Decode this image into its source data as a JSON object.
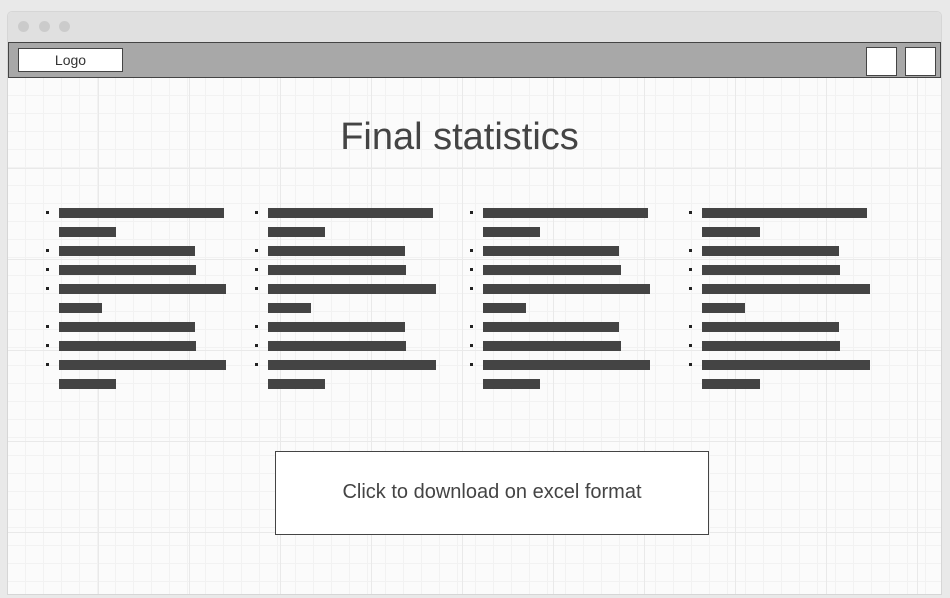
{
  "window": {
    "title": ""
  },
  "toolbar": {
    "logo_label": "Logo",
    "buttons": [
      "toolbar-button-1",
      "toolbar-button-2"
    ]
  },
  "main": {
    "title": "Final statistics",
    "columns": [
      {
        "items": [
          {
            "lines": 2
          },
          {
            "lines": 1
          },
          {
            "lines": 1
          },
          {
            "lines": 2
          },
          {
            "lines": 1
          },
          {
            "lines": 1
          },
          {
            "lines": 2
          }
        ]
      },
      {
        "items": [
          {
            "lines": 2
          },
          {
            "lines": 1
          },
          {
            "lines": 1
          },
          {
            "lines": 2
          },
          {
            "lines": 1
          },
          {
            "lines": 1
          },
          {
            "lines": 2
          }
        ]
      },
      {
        "items": [
          {
            "lines": 2
          },
          {
            "lines": 1
          },
          {
            "lines": 1
          },
          {
            "lines": 2
          },
          {
            "lines": 1
          },
          {
            "lines": 1
          },
          {
            "lines": 2
          }
        ]
      },
      {
        "items": [
          {
            "lines": 2
          },
          {
            "lines": 1
          },
          {
            "lines": 1
          },
          {
            "lines": 2
          },
          {
            "lines": 1
          },
          {
            "lines": 1
          },
          {
            "lines": 2
          }
        ]
      }
    ],
    "download_label": "Click to download on excel format"
  },
  "colors": {
    "toolbar": "#a8a8a8",
    "text_placeholder": "#444444",
    "border": "#444444"
  }
}
